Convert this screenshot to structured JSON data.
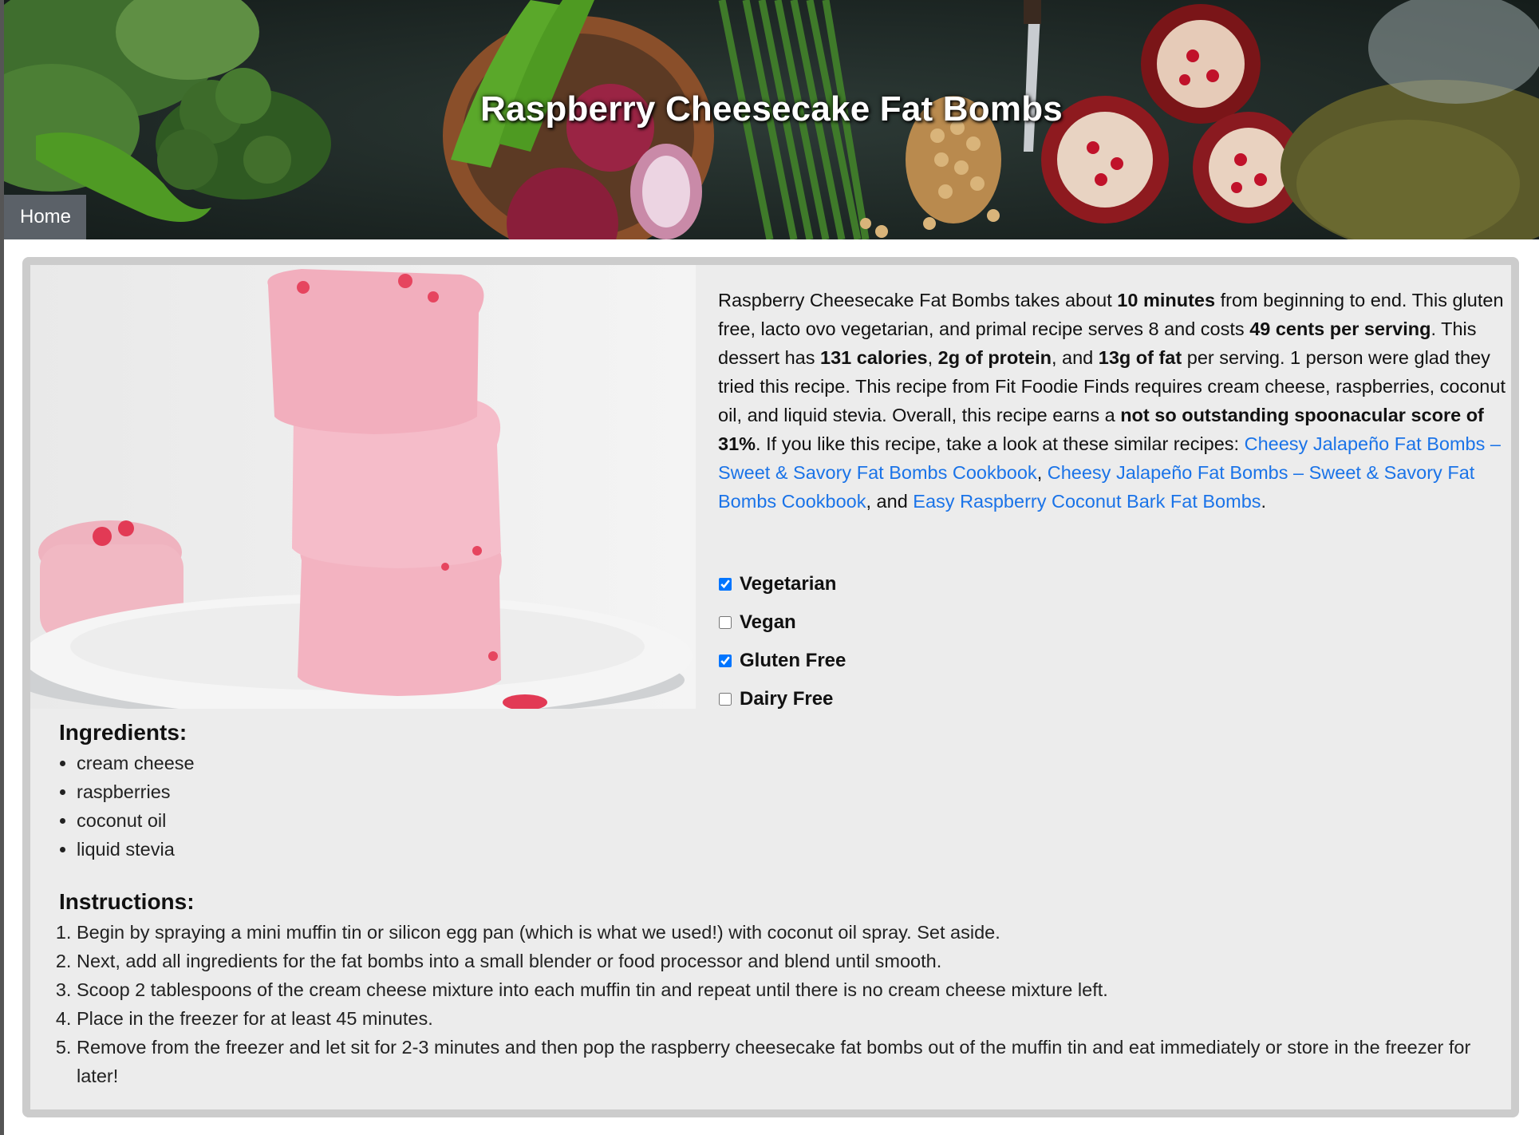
{
  "header": {
    "title": "Raspberry Cheesecake Fat Bombs",
    "nav": {
      "home_label": "Home"
    }
  },
  "summary": {
    "t1": "Raspberry Cheesecake Fat Bombs takes about ",
    "b1": "10 minutes",
    "t2": " from beginning to end. This gluten free, lacto ovo vegetarian, and primal recipe serves 8 and costs ",
    "b2": "49 cents per serving",
    "t3": ". This dessert has ",
    "b3": "131 calories",
    "t4": ", ",
    "b4": "2g of protein",
    "t5": ", and ",
    "b5": "13g of fat",
    "t6": " per serving. 1 person were glad they tried this recipe. This recipe from Fit Foodie Finds requires cream cheese, raspberries, coconut oil, and liquid stevia. Overall, this recipe earns a ",
    "b6": "not so outstanding spoonacular score of 31%",
    "t7": ". If you like this recipe, take a look at these similar recipes: ",
    "link1": "Cheesy Jalapeño Fat Bombs – Sweet & Savory Fat Bombs Cookbook",
    "t8": ", ",
    "link2": "Cheesy Jalapeño Fat Bombs – Sweet & Savory Fat Bombs Cookbook",
    "t9": ", and ",
    "link3": "Easy Raspberry Coconut Bark Fat Bombs",
    "t10": "."
  },
  "diets": [
    {
      "label": "Vegetarian",
      "checked": true
    },
    {
      "label": "Vegan",
      "checked": false
    },
    {
      "label": "Gluten Free",
      "checked": true
    },
    {
      "label": "Dairy Free",
      "checked": false
    }
  ],
  "ingredients": {
    "title": "Ingredients:",
    "items": [
      "cream cheese",
      "raspberries",
      "coconut oil",
      "liquid stevia"
    ]
  },
  "instructions": {
    "title": "Instructions:",
    "steps": [
      "Begin by spraying a mini muffin tin or silicon egg pan (which is what we used!) with coconut oil spray. Set aside.",
      "Next, add all ingredients for the fat bombs into a small blender or food processor and blend until smooth.",
      "Scoop 2 tablespoons of the cream cheese mixture into each muffin tin and repeat until there is no cream cheese mixture left.",
      "Place in the freezer for at least 45 minutes.",
      "Remove from the freezer and let sit for 2-3 minutes and then pop the raspberry cheesecake fat bombs out of the muffin tin and eat immediately or store in the freezer for later!"
    ]
  },
  "colors": {
    "link": "#1a73e8",
    "card_bg": "#ececec",
    "card_border": "#cccccc",
    "nav_bg": "#5b6168"
  }
}
